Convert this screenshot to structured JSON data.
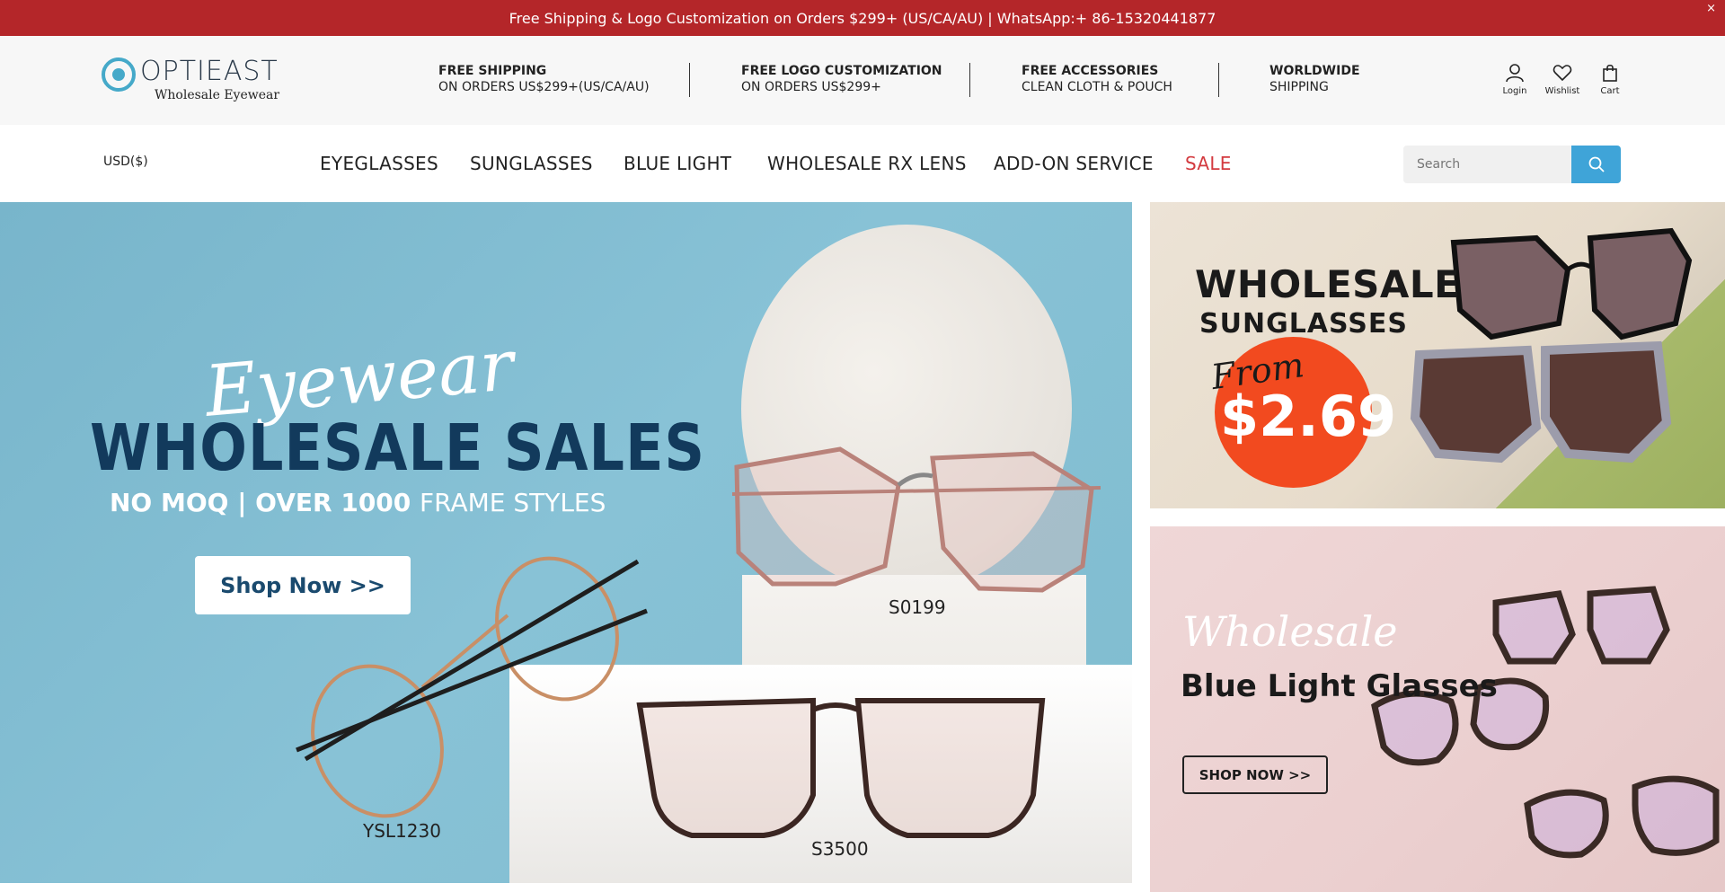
{
  "announcement": {
    "text": "Free Shipping & Logo Customization on Orders $299+ (US/CA/AU) | WhatsApp:+ 86-15320441877",
    "close": "×"
  },
  "header": {
    "logo_name": "OPTIEAST",
    "logo_tagline": "Wholesale Eyewear",
    "benefits": [
      {
        "title": "FREE SHIPPING",
        "desc": "ON ORDERS US$299+(US/CA/AU)"
      },
      {
        "title": "FREE LOGO CUSTOMIZATION",
        "desc": "ON ORDERS US$299+"
      },
      {
        "title": "FREE ACCESSORIES",
        "desc": "CLEAN CLOTH & POUCH"
      },
      {
        "title": "WORLDWIDE",
        "desc": "SHIPPING"
      }
    ],
    "icons": [
      {
        "name": "user-icon",
        "label": "Login"
      },
      {
        "name": "heart-icon",
        "label": "Wishlist"
      },
      {
        "name": "bag-icon",
        "label": "Cart"
      }
    ]
  },
  "nav": {
    "currency": "USD($)",
    "items": [
      "EYEGLASSES",
      "SUNGLASSES",
      "BLUE LIGHT",
      "WHOLESALE RX LENS",
      "ADD-ON SERVICE",
      "SALE"
    ],
    "search_placeholder": "Search"
  },
  "hero": {
    "script": "Eyewear",
    "headline": "WHOLESALE SALES",
    "sub_bold": "NO MOQ | OVER 1000",
    "sub_light": "FRAME STYLES",
    "cta": "Shop Now >>",
    "labels": [
      "S0199",
      "YSL1230",
      "S3500"
    ]
  },
  "banner_sunglasses": {
    "line1": "WHOLESALE",
    "line2": "SUNGLASSES",
    "from": "From",
    "price": "$2.69"
  },
  "banner_bluelight": {
    "script": "Wholesale",
    "title": "Blue Light Glasses",
    "cta": "SHOP NOW >>"
  },
  "colors": {
    "announcement_bg": "#b42629",
    "brand_blue": "#45a9c9",
    "search_button": "#3fa4d8",
    "sale": "#d33a3f"
  }
}
